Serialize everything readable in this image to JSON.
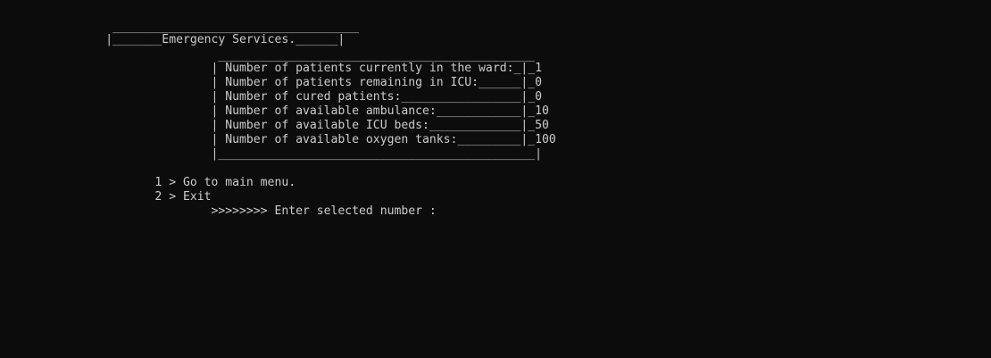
{
  "console": {
    "lines": [
      "                ___________________________________",
      "               |_______Emergency Services.______|",
      "                               _____________________________________________",
      "                              | Number of patients currently in the ward:_|_1",
      "                              | Number of patients remaining in ICU:______|_0",
      "                              | Number of cured patients:_________________|_0",
      "                              | Number of available ambulance:____________|_10",
      "                              | Number of available ICU beds:_____________|_50",
      "                              | Number of available oxygen tanks:_________|_100",
      "                              |_____________________________________________|",
      "",
      "                      1 > Go to main menu.",
      "                      2 > Exit",
      "                              >>>>>>>> Enter selected number :"
    ]
  }
}
